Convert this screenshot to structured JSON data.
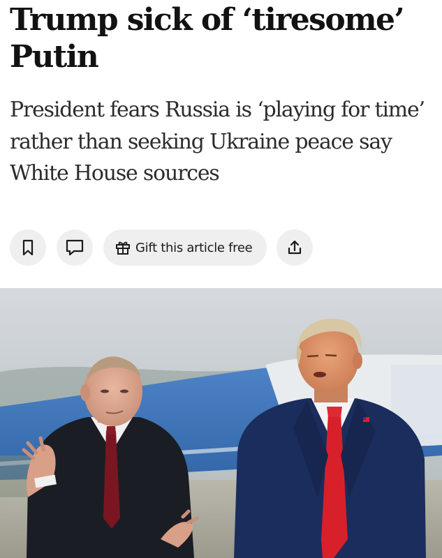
{
  "article": {
    "headline": "Trump sick of ‘tiresome’ Putin",
    "standfirst": "President fears Russia is ‘playing for time’ rather than seeking Ukraine peace say White House sources"
  },
  "actions": {
    "bookmark_icon": "bookmark-icon",
    "comment_icon": "comment-icon",
    "gift_icon": "gift-icon",
    "gift_label": "Gift this article free",
    "share_icon": "share-icon"
  },
  "colors": {
    "button_bg": "#efefef",
    "text": "#121212",
    "trump_tie": "#d8202a",
    "suit_navy": "#1b2d5c"
  }
}
